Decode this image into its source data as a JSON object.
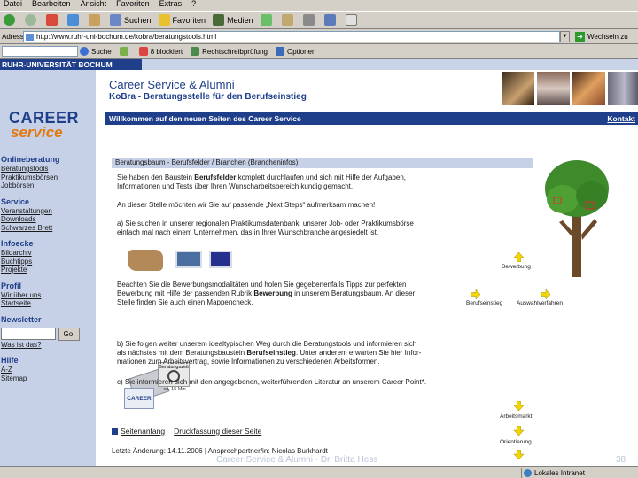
{
  "browser": {
    "menu": [
      "Datei",
      "Bearbeiten",
      "Ansicht",
      "Favoriten",
      "Extras",
      "?"
    ],
    "toolbar": {
      "search": "Suchen",
      "favorites": "Favoriten",
      "media": "Medien"
    },
    "address_label": "Adresse",
    "url": "http://www.ruhr-uni-bochum.de/kobra/beratungstools.html",
    "go_label": "Wechseln zu",
    "google": {
      "search_label": "Suche",
      "blocked": "8 blockiert",
      "spellcheck": "Rechtschreibprüfung",
      "options": "Optionen"
    },
    "status_zone": "Lokales Intranet"
  },
  "page": {
    "university_bar": "RUHR-UNIVERSITÄT BOCHUM",
    "logo": {
      "line1": "CAREER",
      "line2": "service"
    },
    "header_title": "Career Service & Alumni",
    "header_subtitle": "KoBra - Beratungsstelle für den Berufseinstieg",
    "welcome": "Willkommen auf den neuen Seiten des Career Service",
    "contact": "Kontakt",
    "nav": [
      {
        "head": "Onlineberatung",
        "items": [
          "Beratungstools",
          "Praktikumsbörsen",
          "Jobbörsen"
        ]
      },
      {
        "head": "Service",
        "items": [
          "Veranstaltungen",
          "Downloads",
          "Schwarzes Brett"
        ]
      },
      {
        "head": "Infoecke",
        "items": [
          "Bildarchiv",
          "Buchtipps",
          "Projekte"
        ]
      },
      {
        "head": "Profil",
        "items": [
          "Wir über uns",
          "Startseite"
        ]
      }
    ],
    "newsletter": {
      "head": "Newsletter",
      "button": "Go!",
      "link": "Was ist das?"
    },
    "help": {
      "head": "Hilfe",
      "items": [
        "A-Z",
        "Sitemap"
      ]
    },
    "box_title": "Beratungsbaum - Berufsfelder / Branchen (Brancheninfos)",
    "intro_1": "Sie haben den Baustein",
    "intro_bold": "Berufsfelder",
    "intro_2": "komplett durchlaufen und sich mit Hilfe der Aufgaben,",
    "intro_3": "Informationen und Tests über Ihren Wunscharbeitsbereich kundig gemacht.",
    "next_steps": "An dieser Stelle möchten wir Sie auf passende „Next Steps“ aufmerksam machen!",
    "a_1": "a) Sie suchen in unserer regionalen Praktikumsdatenbank, unserer Job- oder Praktikumsbörse",
    "a_2": "einfach mal nach einem Unternehmen, das in Ihrer Wunschbranche angesiedelt ist.",
    "b0_1": "Beachten Sie die Bewerbungsmodalitäten und holen Sie gegebenenfalls Tipps zur perfekten",
    "b0_2a": "Bewerbung mit Hilfe der passenden Rubrik",
    "b0_2bold": "Bewerbung",
    "b0_2b": "in unserem Beratungsbaum. An dieser",
    "b0_3": "Stelle finden Sie auch einen Mappencheck.",
    "clock_label": "Beratungszeit",
    "clock_caption": "ca. 15 Min",
    "b_1": "b) Sie folgen weiter unserem idealtypischen Weg durch die Beratungstools und informieren sich",
    "b_2a": "als nächstes mit dem Beratungsbaustein",
    "b_2bold": "Berufseinstieg",
    "b_2b": ". Unter anderem erwarten Sie hier Infor-",
    "b_3": "mationen zum Arbeitsvertrag, sowie Informationen zu verschiedenen Arbeitsformen.",
    "c_1": "c) Sie informieren sich mit den angegebenen, weiterführenden Literatur an unserem Career Point*.",
    "career_badge": "CAREER",
    "tree_labels": {
      "bewerbung": "Bewerbung",
      "berufseinstieg": "Berufseinstieg",
      "auswahlverfahren": "Auswahlverfahren",
      "arbeitsmarkt": "Arbeitsmarkt",
      "orientierung": "Orientierung"
    },
    "footer_top": "Seitenanfang",
    "footer_print": "Druckfassung dieser Seite",
    "update_line": "Letzte Änderung: 14.11.2006 | Ansprechpartner/in: Nicolas Burkhardt"
  },
  "slide": {
    "footer": "Career Service & Alumni - Dr. Britta Hess",
    "number": "38"
  },
  "colors": {
    "brand_blue": "#1f3f8a",
    "nav_bg": "#c6d0e6",
    "accent_orange": "#e07a12",
    "arrow_yellow": "#f2d600"
  }
}
